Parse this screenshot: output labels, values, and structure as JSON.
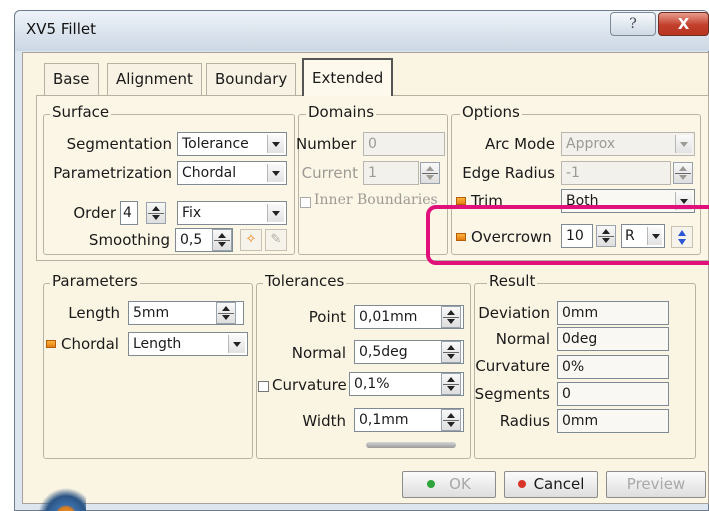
{
  "window": {
    "title": "XV5 Fillet",
    "help_glyph": "?",
    "close_glyph": "X"
  },
  "tabs": [
    {
      "label": "Base",
      "active": false
    },
    {
      "label": "Alignment",
      "active": false
    },
    {
      "label": "Boundary",
      "active": false
    },
    {
      "label": "Extended",
      "active": true
    }
  ],
  "surface": {
    "legend": "Surface",
    "segmentation": {
      "label": "Segmentation",
      "value": "Tolerance"
    },
    "parametrization": {
      "label": "Parametrization",
      "value": "Chordal"
    },
    "order": {
      "label": "Order",
      "value": "4",
      "mode": "Fix"
    },
    "smoothing": {
      "label": "Smoothing",
      "value": "0,5"
    }
  },
  "domains": {
    "legend": "Domains",
    "number": {
      "label": "Number",
      "value": "0"
    },
    "current": {
      "label": "Current",
      "value": "1"
    },
    "inner_boundaries": {
      "label": "Inner Boundaries",
      "checked": false
    }
  },
  "options": {
    "legend": "Options",
    "arc_mode": {
      "label": "Arc Mode",
      "value": "Approx"
    },
    "edge_radius": {
      "label": "Edge Radius",
      "value": "-1"
    },
    "trim": {
      "label": "Trim",
      "value": "Both"
    },
    "overcrown": {
      "label": "Overcrown",
      "value": "10",
      "mode": "R"
    }
  },
  "parameters": {
    "legend": "Parameters",
    "length": {
      "label": "Length",
      "value": "5mm"
    },
    "chordal": {
      "label": "Chordal",
      "value": "Length"
    }
  },
  "tolerances": {
    "legend": "Tolerances",
    "point": {
      "label": "Point",
      "value": "0,01mm"
    },
    "normal": {
      "label": "Normal",
      "value": "0,5deg"
    },
    "curvature": {
      "label": "Curvature",
      "value": "0,1%",
      "checked": false
    },
    "width": {
      "label": "Width",
      "value": "0,1mm"
    }
  },
  "result": {
    "legend": "Result",
    "deviation": {
      "label": "Deviation",
      "value": "0mm"
    },
    "normal": {
      "label": "Normal",
      "value": "0deg"
    },
    "curvature": {
      "label": "Curvature",
      "value": "0%"
    },
    "segments": {
      "label": "Segments",
      "value": "0"
    },
    "radius": {
      "label": "Radius",
      "value": "0mm"
    }
  },
  "buttons": {
    "ok": "OK",
    "cancel": "Cancel",
    "preview": "Preview"
  },
  "colors": {
    "highlight": "#e0117a",
    "ok_led": "#2da53a",
    "cancel_led": "#d8342a",
    "accent_orange": "#f09a23"
  }
}
